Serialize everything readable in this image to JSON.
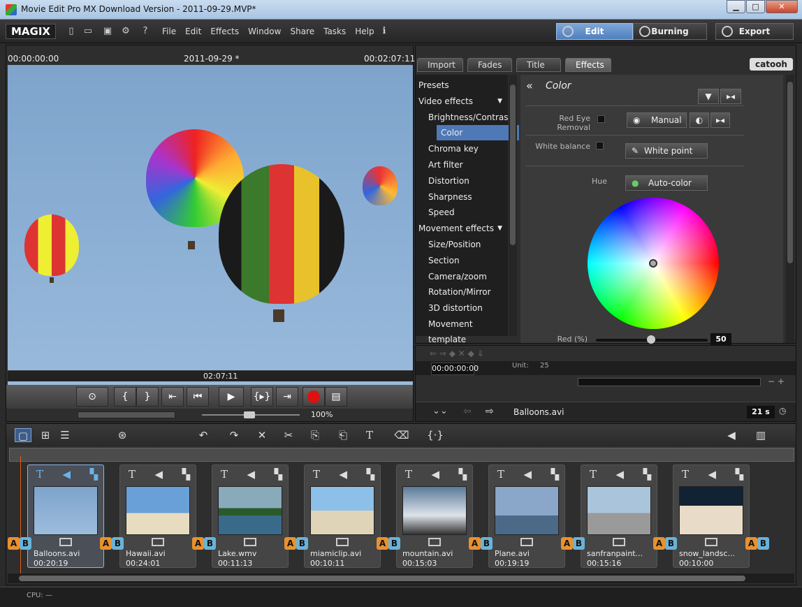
{
  "window": {
    "title": "Movie Edit Pro MX Download Version - 2011-09-29.MVP*"
  },
  "menubar": {
    "logo": "MAGIX",
    "menu": [
      "File",
      "Edit",
      "Effects",
      "Window",
      "Share",
      "Tasks",
      "Help"
    ],
    "modes": {
      "edit": "Edit",
      "burning": "Burning",
      "export": "Export"
    }
  },
  "preview": {
    "time_start": "00:00:00:00",
    "project": "2011-09-29 *",
    "time_end": "00:02:07:11",
    "scrub_time": "02:07:11",
    "zoom": "100%"
  },
  "fx": {
    "tabs": [
      "Import",
      "Fades",
      "Title",
      "Effects"
    ],
    "brand": "catooh",
    "list": [
      {
        "label": "Presets",
        "type": "head"
      },
      {
        "label": "Video effects",
        "type": "head",
        "caret": true
      },
      {
        "label": "Brightness/Contrast",
        "type": "sub"
      },
      {
        "label": "Color",
        "type": "sub",
        "selected": true
      },
      {
        "label": "Chroma key",
        "type": "sub"
      },
      {
        "label": "Art filter",
        "type": "sub"
      },
      {
        "label": "Distortion",
        "type": "sub"
      },
      {
        "label": "Sharpness",
        "type": "sub"
      },
      {
        "label": "Speed",
        "type": "sub"
      },
      {
        "label": "Movement effects",
        "type": "head",
        "caret": true
      },
      {
        "label": "Size/Position",
        "type": "sub"
      },
      {
        "label": "Section",
        "type": "sub"
      },
      {
        "label": "Camera/zoom",
        "type": "sub"
      },
      {
        "label": "Rotation/Mirror",
        "type": "sub"
      },
      {
        "label": "3D distortion",
        "type": "sub"
      },
      {
        "label": "Movement template",
        "type": "sub"
      }
    ],
    "section_title": "Color",
    "red_eye_label": "Red Eye Removal",
    "manual_label": "Manual",
    "white_balance_label": "White balance",
    "white_point_label": "White point",
    "hue_label": "Hue",
    "auto_color_label": "Auto-color",
    "red_label": "Red (%)",
    "red_value": "50"
  },
  "mini": {
    "timecode": "00:00:00:00",
    "unit_label": "Unit:",
    "unit_value": "25",
    "file": "Balloons.avi",
    "duration": "21 s"
  },
  "clips": [
    {
      "name": "Balloons.avi",
      "dur": "00:20:19",
      "selected": true
    },
    {
      "name": "Hawaii.avi",
      "dur": "00:24:01"
    },
    {
      "name": "Lake.wmv",
      "dur": "00:11:13"
    },
    {
      "name": "miamiclip.avi",
      "dur": "00:10:11"
    },
    {
      "name": "mountain.avi",
      "dur": "00:15:03"
    },
    {
      "name": "Plane.avi",
      "dur": "00:19:19"
    },
    {
      "name": "sanfranpaint...",
      "dur": "00:15:16"
    },
    {
      "name": "snow_landsc...",
      "dur": "00:10:00"
    }
  ],
  "status": {
    "cpu": "CPU: —"
  }
}
